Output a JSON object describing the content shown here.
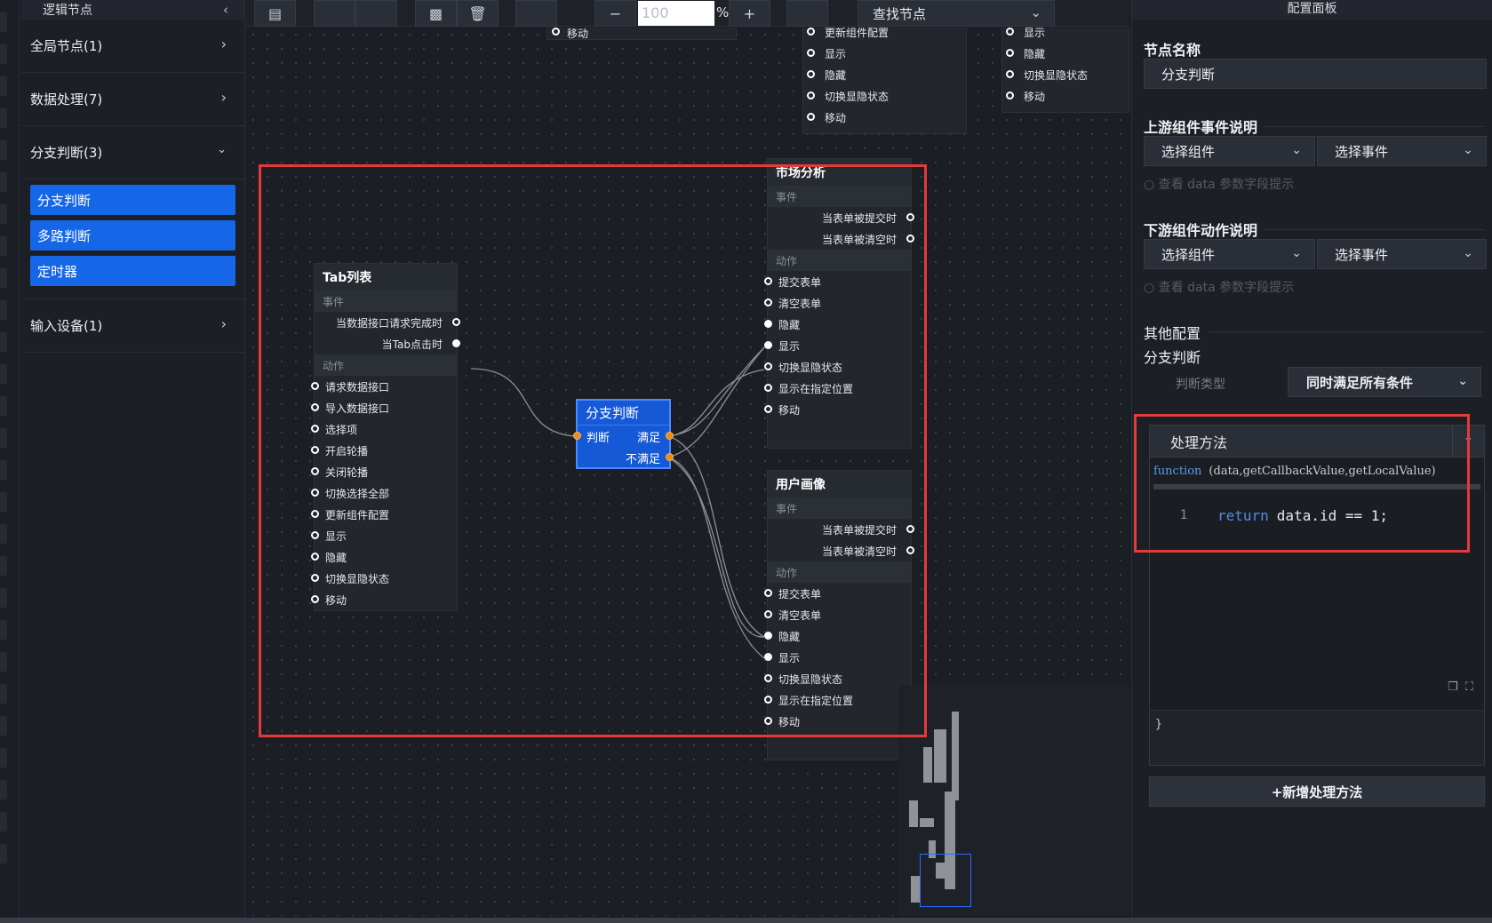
{
  "sidebar": {
    "title": "逻辑节点",
    "collapse_icon": "chevron-left",
    "categories": [
      {
        "label": "全局节点(1)",
        "expanded": false
      },
      {
        "label": "数据处理(7)",
        "expanded": false
      },
      {
        "label": "分支判断(3)",
        "expanded": true
      },
      {
        "label": "输入设备(1)",
        "expanded": false
      }
    ],
    "branch_items": [
      "分支判断",
      "多路判断",
      "定时器"
    ]
  },
  "toolbar": {
    "zoom_value": "100",
    "zoom_suffix": "%",
    "zoom_out": "−",
    "zoom_in": "+",
    "search_label": "查找节点"
  },
  "canvas": {
    "top_fragment_1": {
      "items": [
        "移动"
      ]
    },
    "top_fragment_2": {
      "items": [
        "更新组件配置",
        "显示",
        "隐藏",
        "切换显隐状态",
        "移动"
      ]
    },
    "top_fragment_3": {
      "items": [
        "显示",
        "隐藏",
        "切换显隐状态",
        "移动"
      ]
    },
    "tab_node": {
      "title": "Tab列表",
      "events_label": "事件",
      "events": [
        "当数据接口请求完成时",
        "当Tab点击时"
      ],
      "actions_label": "动作",
      "actions": [
        "请求数据接口",
        "导入数据接口",
        "选择项",
        "开启轮播",
        "关闭轮播",
        "切换选择全部",
        "更新组件配置",
        "显示",
        "隐藏",
        "切换显隐状态",
        "移动"
      ]
    },
    "branch_node": {
      "title": "分支判断",
      "input": "判断",
      "yes": "满足",
      "no": "不满足"
    },
    "market_node": {
      "title": "市场分析",
      "events_label": "事件",
      "events": [
        "当表单被提交时",
        "当表单被清空时"
      ],
      "actions_label": "动作",
      "actions": [
        "提交表单",
        "清空表单",
        "隐藏",
        "显示",
        "切换显隐状态",
        "显示在指定位置",
        "移动"
      ]
    },
    "user_node": {
      "title": "用户画像",
      "events_label": "事件",
      "events": [
        "当表单被提交时",
        "当表单被清空时"
      ],
      "actions_label": "动作",
      "actions": [
        "提交表单",
        "清空表单",
        "隐藏",
        "显示",
        "切换显隐状态",
        "显示在指定位置",
        "移动"
      ]
    }
  },
  "panel": {
    "title": "配置面板",
    "node_name_label": "节点名称",
    "node_name_value": "分支判断",
    "upstream_label": "上游组件事件说明",
    "downstream_label": "下游组件动作说明",
    "select_component": "选择组件",
    "select_event": "选择事件",
    "hint": "查看 data 参数字段提示",
    "other_label": "其他配置",
    "branch_label": "分支判断",
    "judge_type_label": "判断类型",
    "judge_type_value": "同时满足所有条件",
    "method_title": "处理方法",
    "func_keyword": "function",
    "func_params": "(data,getCallbackValue,getLocalValue)",
    "code_line_no": "1",
    "code_return": "return",
    "code_body": "data.id == 1;",
    "code_close": "}",
    "add_method": "+新增处理方法"
  }
}
